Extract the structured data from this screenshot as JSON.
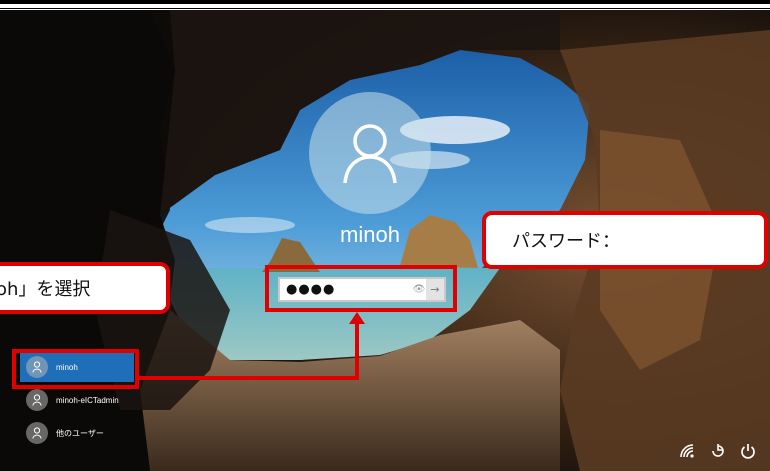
{
  "lock_screen": {
    "username": "minoh",
    "password_mask": "●●●●",
    "password_eye": "👁",
    "submit_arrow": "→"
  },
  "callouts": {
    "select_user": "oh」を選択",
    "password": "パスワード："
  },
  "user_list": [
    {
      "name": "minoh",
      "selected": true
    },
    {
      "name": "minoh-eICTadmin",
      "selected": false
    },
    {
      "name": "他のユーザー",
      "selected": false
    }
  ],
  "system_icons": [
    "wifi-icon",
    "accessibility-icon",
    "power-icon"
  ],
  "colors": {
    "highlight": "#e00000",
    "selected_user": "#1f6fb8"
  }
}
